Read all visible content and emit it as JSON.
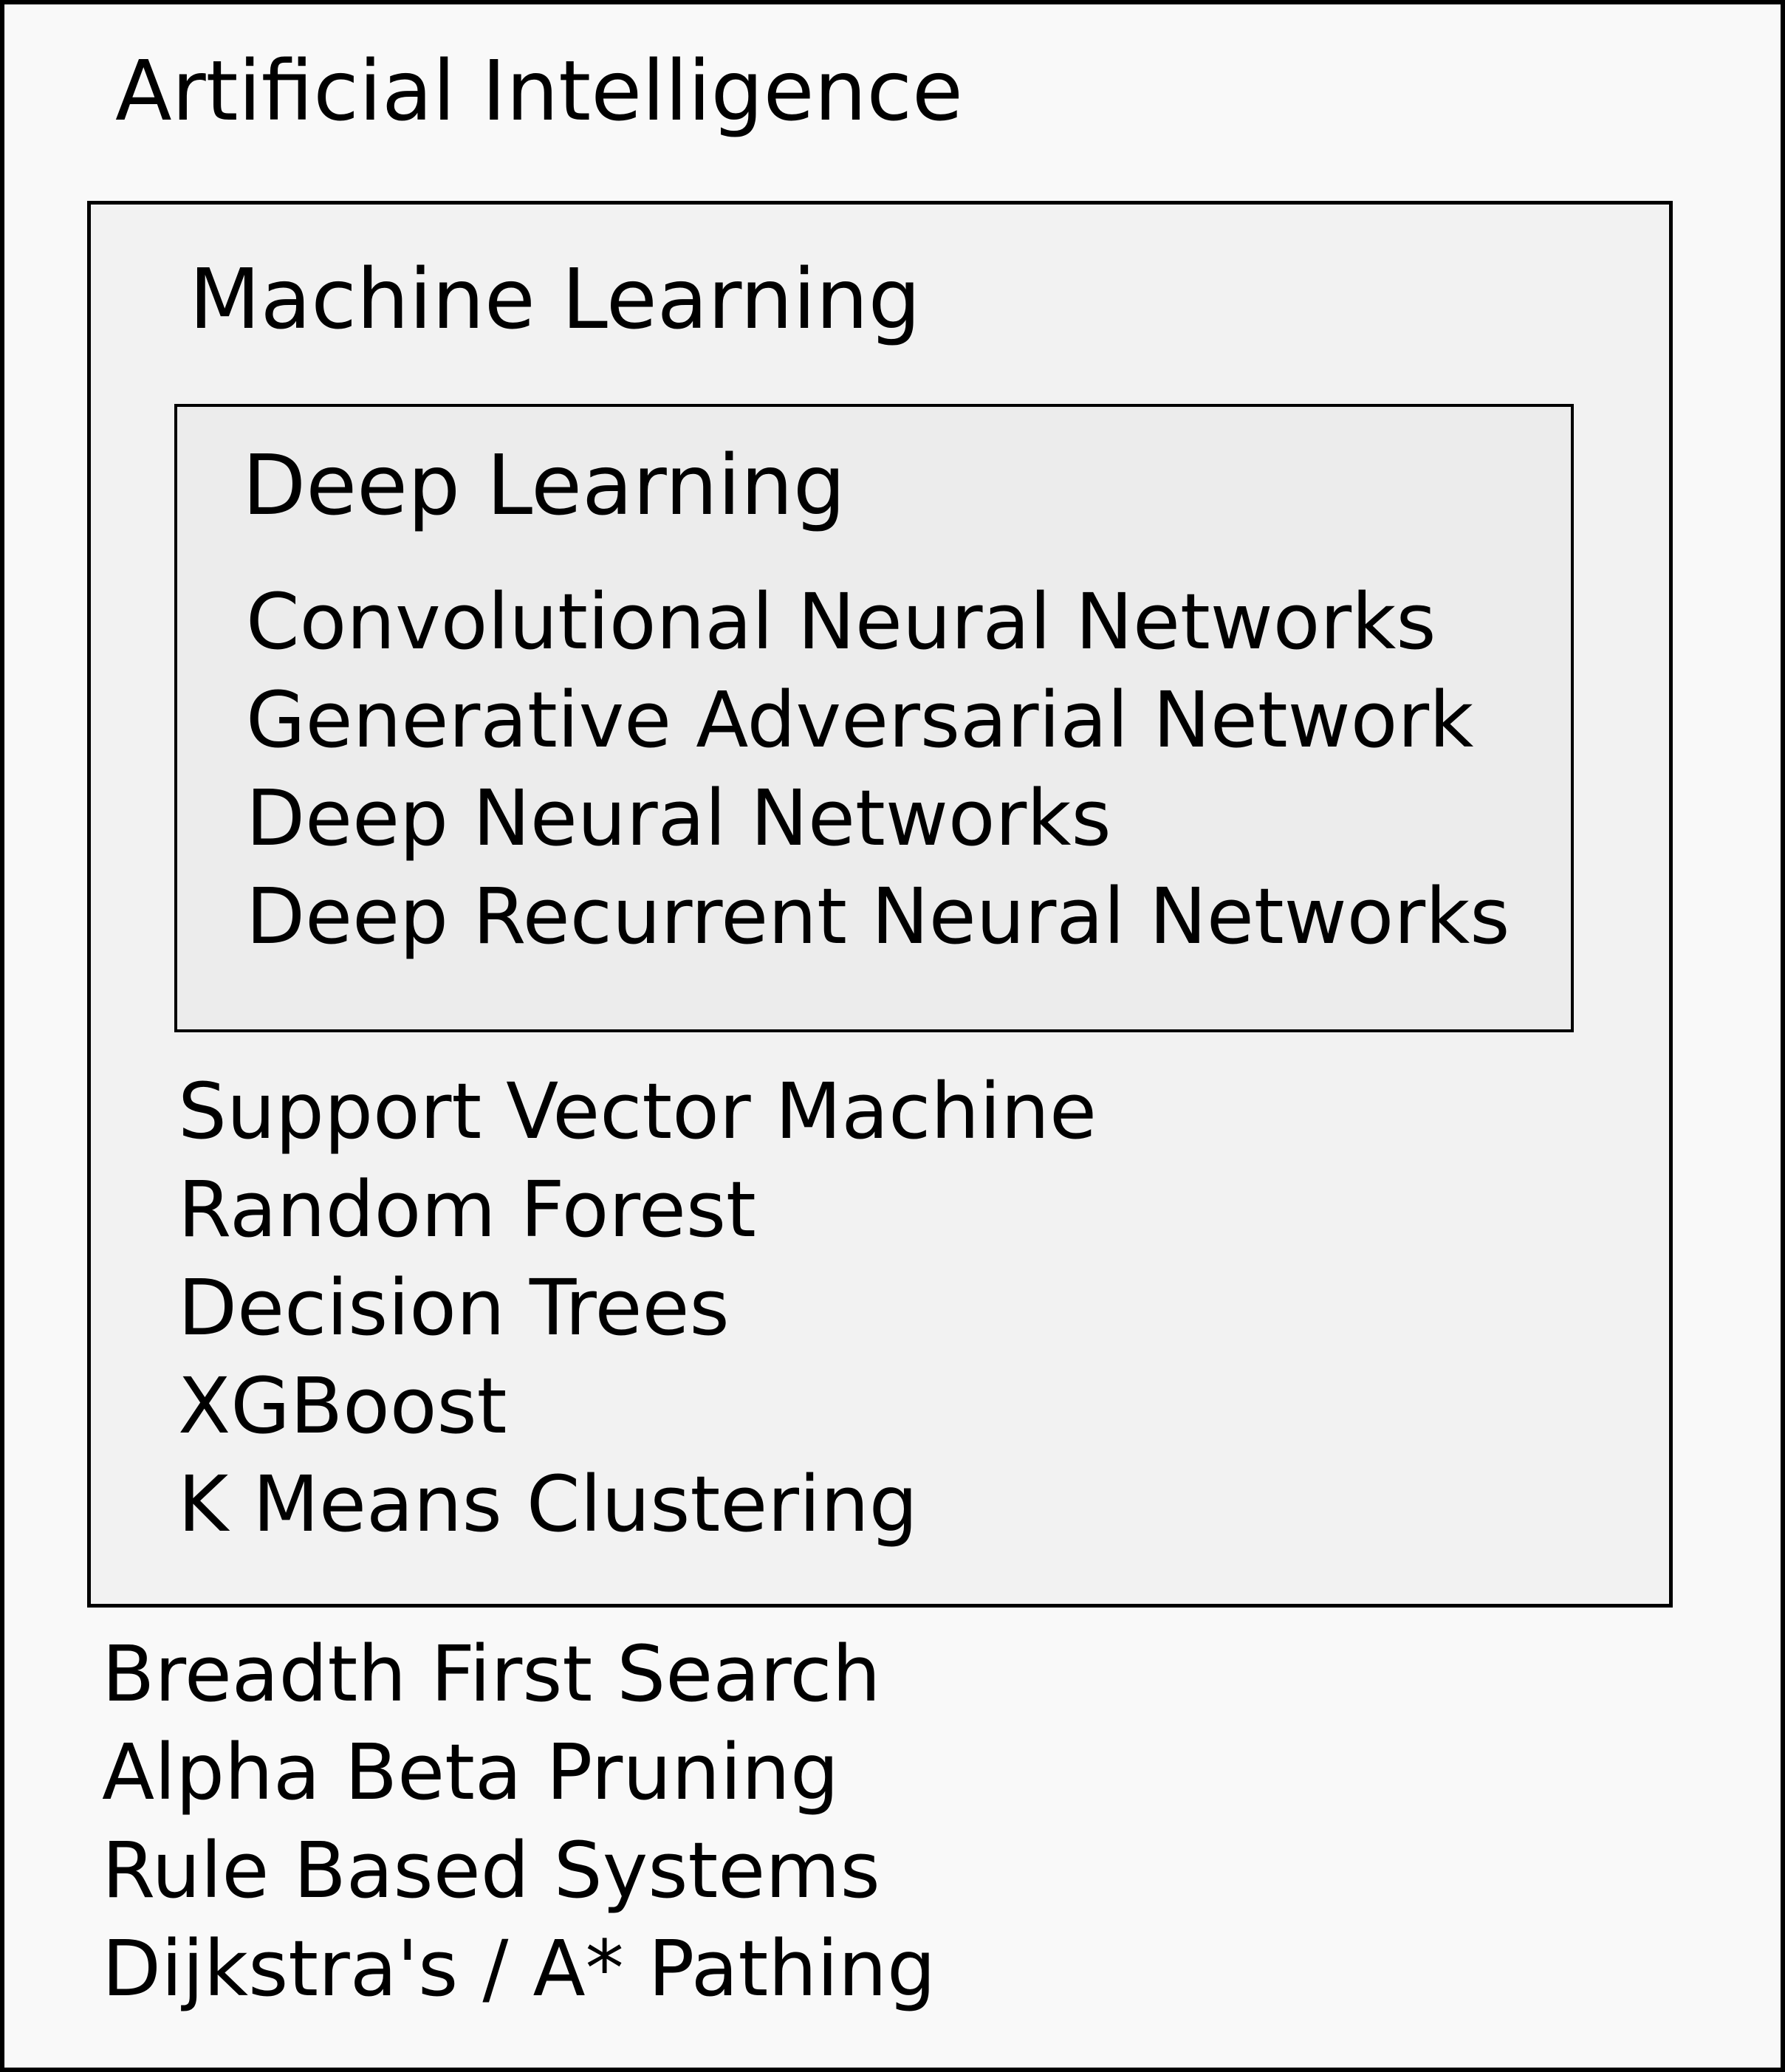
{
  "colors": {
    "ai_fill": "#f9f9f9",
    "ml_fill": "#f2f2f2",
    "dl_fill": "#ececec",
    "border": "#000000",
    "text": "#000000"
  },
  "artificial_intelligence": {
    "title": "Artificial Intelligence",
    "items": [
      "Breadth First Search",
      "Alpha Beta Pruning",
      "Rule Based Systems",
      "Dijkstra's / A* Pathing"
    ]
  },
  "machine_learning": {
    "title": "Machine Learning",
    "items": [
      "Support Vector Machine",
      "Random Forest",
      "Decision Trees",
      "XGBoost",
      "K Means Clustering"
    ]
  },
  "deep_learning": {
    "title": "Deep Learning",
    "items": [
      "Convolutional Neural Networks",
      "Generative Adversarial Network",
      "Deep Neural Networks",
      "Deep Recurrent Neural Networks"
    ]
  }
}
